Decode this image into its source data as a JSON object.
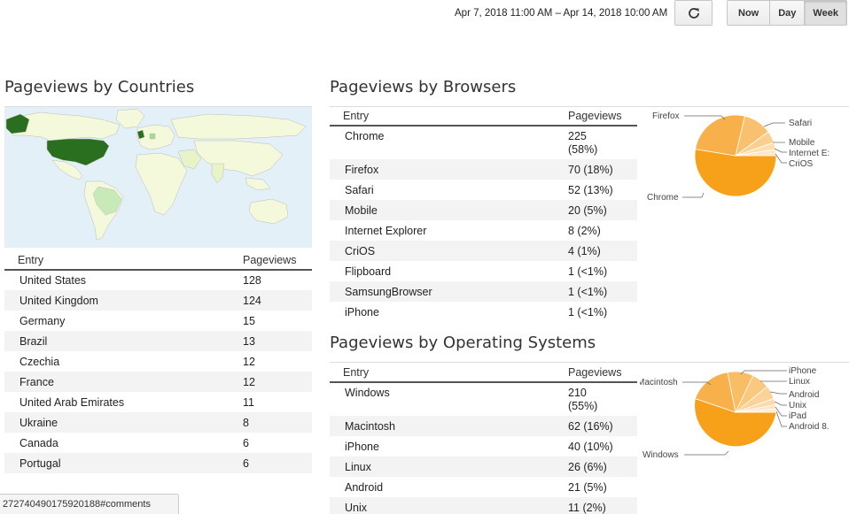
{
  "header": {
    "date_range": "Apr 7, 2018 11:00 AM – Apr 14, 2018 10:00 AM",
    "range_buttons": [
      "Now",
      "Day",
      "Week"
    ],
    "active_range": "Week"
  },
  "countries": {
    "title": "Pageviews by Countries",
    "col_entry": "Entry",
    "col_pageviews": "Pageviews",
    "rows": [
      {
        "entry": "United States",
        "pv": "128"
      },
      {
        "entry": "United Kingdom",
        "pv": "124"
      },
      {
        "entry": "Germany",
        "pv": "15"
      },
      {
        "entry": "Brazil",
        "pv": "13"
      },
      {
        "entry": "Czechia",
        "pv": "12"
      },
      {
        "entry": "France",
        "pv": "12"
      },
      {
        "entry": "United Arab Emirates",
        "pv": "11"
      },
      {
        "entry": "Ukraine",
        "pv": "8"
      },
      {
        "entry": "Canada",
        "pv": "6"
      },
      {
        "entry": "Portugal",
        "pv": "6"
      }
    ]
  },
  "browsers": {
    "title": "Pageviews by Browsers",
    "col_entry": "Entry",
    "col_pageviews": "Pageviews",
    "rows": [
      {
        "entry": "Chrome",
        "pv": "225",
        "pct": "(58%)"
      },
      {
        "entry": "Firefox",
        "pv": "70 (18%)"
      },
      {
        "entry": "Safari",
        "pv": "52 (13%)"
      },
      {
        "entry": "Mobile",
        "pv": "20 (5%)"
      },
      {
        "entry": "Internet Explorer",
        "pv": "8 (2%)"
      },
      {
        "entry": "CriOS",
        "pv": "4 (1%)"
      },
      {
        "entry": "Flipboard",
        "pv": "1 (<1%)"
      },
      {
        "entry": "SamsungBrowser",
        "pv": "1 (<1%)"
      },
      {
        "entry": "iPhone",
        "pv": "1 (<1%)"
      }
    ],
    "pie_labels": [
      "Firefox",
      "Chrome",
      "Safari",
      "Mobile",
      "Internet E:",
      "CriOS"
    ]
  },
  "os": {
    "title": "Pageviews by Operating Systems",
    "col_entry": "Entry",
    "col_pageviews": "Pageviews",
    "rows": [
      {
        "entry": "Windows",
        "pv": "210",
        "pct": "(55%)"
      },
      {
        "entry": "Macintosh",
        "pv": "62 (16%)"
      },
      {
        "entry": "iPhone",
        "pv": "40 (10%)"
      },
      {
        "entry": "Linux",
        "pv": "26 (6%)"
      },
      {
        "entry": "Android",
        "pv": "21 (5%)"
      },
      {
        "entry": "Unix",
        "pv": "11 (2%)"
      }
    ],
    "pie_labels": [
      "Macintosh",
      "Windows",
      "iPhone",
      "Linux",
      "Android",
      "Unix",
      "iPad",
      "Android 8."
    ]
  },
  "statusbar": {
    "text": "272740490175920188#comments"
  },
  "colors": {
    "pie_main": "#f7a11a",
    "map_top": "#2a6e1f",
    "map_light": "#f5f9dc"
  }
}
